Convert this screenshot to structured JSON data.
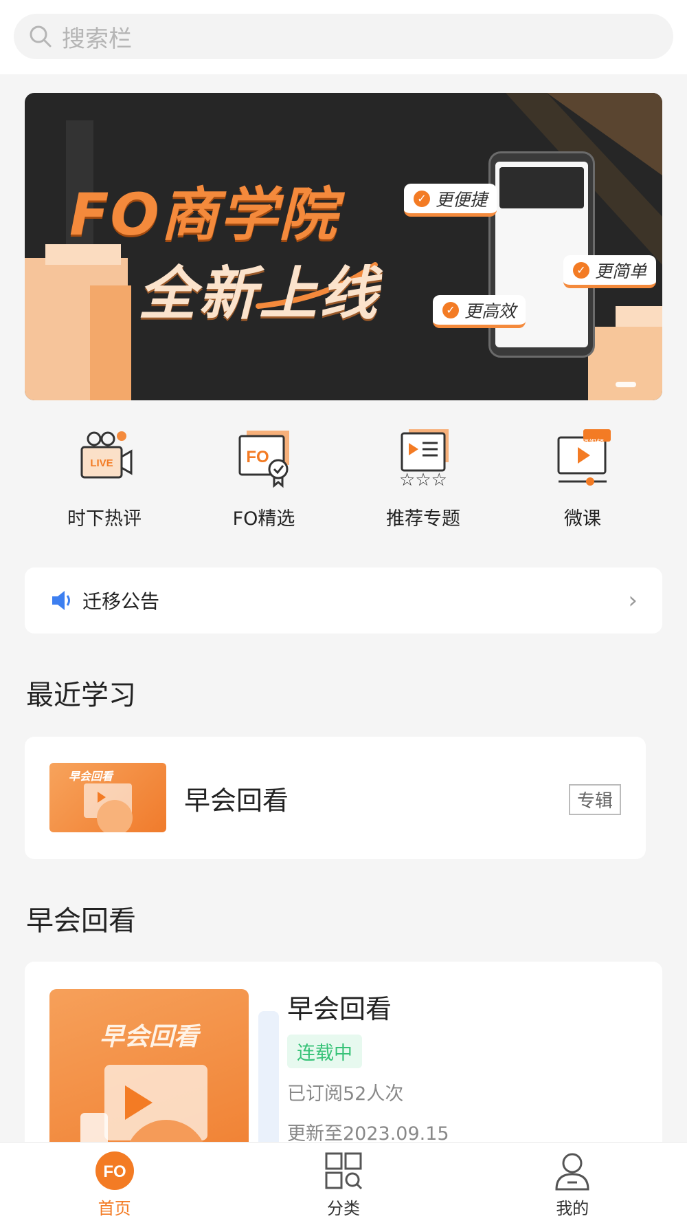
{
  "search": {
    "placeholder": "搜索栏"
  },
  "banner": {
    "title_line1": "FO商学院",
    "title_line2": "全新上线",
    "tags": [
      "更便捷",
      "更简单",
      "更高效"
    ]
  },
  "entries": [
    {
      "label": "时下热评",
      "icon": "live-camera-icon"
    },
    {
      "label": "FO精选",
      "icon": "fo-select-icon"
    },
    {
      "label": "推荐专题",
      "icon": "recommend-topic-icon"
    },
    {
      "label": "微课",
      "icon": "micro-lesson-icon",
      "badge": "短视频"
    }
  ],
  "notice": {
    "label": "迁移公告"
  },
  "recent": {
    "section_title": "最近学习",
    "item": {
      "thumb_text": "早会回看",
      "title": "早会回看",
      "badge": "专辑"
    }
  },
  "album": {
    "section_title": "早会回看",
    "cover_text": "早会回看",
    "title": "早会回看",
    "status": "连载中",
    "subscribers": "已订阅52人次",
    "updated": "更新至2023.09.15"
  },
  "tabs": [
    {
      "label": "首页",
      "icon": "home-fo-icon",
      "active": true
    },
    {
      "label": "分类",
      "icon": "category-icon",
      "active": false
    },
    {
      "label": "我的",
      "icon": "profile-icon",
      "active": false
    }
  ],
  "colors": {
    "accent": "#f37b24",
    "status_green": "#36c277",
    "bg": "#f5f5f5"
  }
}
